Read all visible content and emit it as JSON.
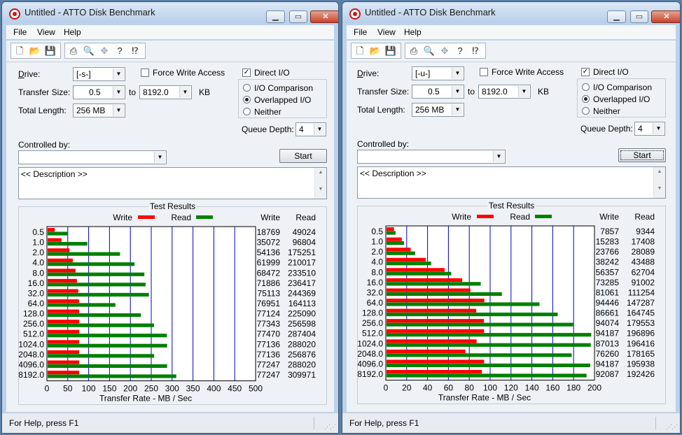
{
  "windows": [
    {
      "id": "left",
      "title": "Untitled - ATTO Disk Benchmark",
      "menu": [
        "File",
        "View",
        "Help"
      ],
      "drive": "[-s-]",
      "transfer_from": "0.5",
      "to_label": "to",
      "transfer_to": "8192.0",
      "unit": "KB",
      "total_length": "256 MB",
      "force_write_access": false,
      "direct_io": true,
      "io_mode": "Overlapped I/O",
      "queue_depth": "4",
      "controlled_by": "",
      "description": "<< Description >>",
      "status": "For Help, press F1",
      "start_label": "Start",
      "start_focused": false
    },
    {
      "id": "right",
      "title": "Untitled - ATTO Disk Benchmark",
      "menu": [
        "File",
        "View",
        "Help"
      ],
      "drive": "[-u-]",
      "transfer_from": "0.5",
      "to_label": "to",
      "transfer_to": "8192.0",
      "unit": "KB",
      "total_length": "256 MB",
      "force_write_access": false,
      "direct_io": true,
      "io_mode": "Overlapped I/O",
      "queue_depth": "4",
      "controlled_by": "",
      "description": "<< Description >>",
      "status": "For Help, press F1",
      "start_label": "Start",
      "start_focused": true
    }
  ],
  "labels": {
    "drive": "Drive:",
    "transfer_size": "Transfer Size:",
    "total_length": "Total Length:",
    "force_write_access": "Force Write Access",
    "direct_io": "Direct I/O",
    "io_comparison": "I/O Comparison",
    "overlapped_io": "Overlapped I/O",
    "neither": "Neither",
    "queue_depth": "Queue Depth:",
    "controlled_by": "Controlled by:",
    "test_results": "Test Results"
  },
  "colors": {
    "write": "#ff0000",
    "read": "#008000",
    "grid": "#0000c8"
  },
  "chart_data": [
    {
      "type": "bar",
      "orientation": "horizontal",
      "title": "Test Results",
      "categories": [
        "0.5",
        "1.0",
        "2.0",
        "4.0",
        "8.0",
        "16.0",
        "32.0",
        "64.0",
        "128.0",
        "256.0",
        "512.0",
        "1024.0",
        "2048.0",
        "4096.0",
        "8192.0"
      ],
      "series": [
        {
          "name": "Write",
          "values": [
            18769,
            35072,
            54136,
            61999,
            68472,
            71886,
            75113,
            76951,
            77124,
            77343,
            77470,
            77136,
            77136,
            77247,
            77247
          ]
        },
        {
          "name": "Read",
          "values": [
            49024,
            96804,
            175251,
            210017,
            233510,
            236417,
            244369,
            164113,
            225090,
            256598,
            287404,
            288020,
            256876,
            288020,
            309971
          ]
        }
      ],
      "column_headers": [
        "Write",
        "Read"
      ],
      "xlabel": "Transfer Rate - MB / Sec",
      "xlim": [
        0,
        400
      ],
      "xticks": [
        0,
        50,
        100,
        150,
        200,
        250,
        300,
        350,
        400,
        450,
        500
      ],
      "value_scale_per_unit": 1000
    },
    {
      "type": "bar",
      "orientation": "horizontal",
      "title": "Test Results",
      "categories": [
        "0.5",
        "1.0",
        "2.0",
        "4.0",
        "8.0",
        "16.0",
        "32.0",
        "64.0",
        "128.0",
        "256.0",
        "512.0",
        "1024.0",
        "2048.0",
        "4096.0",
        "8192.0"
      ],
      "series": [
        {
          "name": "Write",
          "values": [
            7857,
            15283,
            23766,
            38242,
            56357,
            73285,
            81061,
            94446,
            86661,
            94074,
            94187,
            87013,
            76260,
            94187,
            92087
          ]
        },
        {
          "name": "Read",
          "values": [
            9344,
            17408,
            28089,
            43488,
            62704,
            91002,
            111254,
            147287,
            164745,
            179553,
            196896,
            196416,
            178165,
            195938,
            192426
          ]
        }
      ],
      "column_headers": [
        "Write",
        "Read"
      ],
      "xlabel": "Transfer Rate - MB / Sec",
      "xlim": [
        0,
        200
      ],
      "xticks": [
        0,
        20,
        40,
        60,
        80,
        100,
        120,
        140,
        160,
        180,
        200
      ],
      "value_scale_per_unit": 1000
    }
  ]
}
